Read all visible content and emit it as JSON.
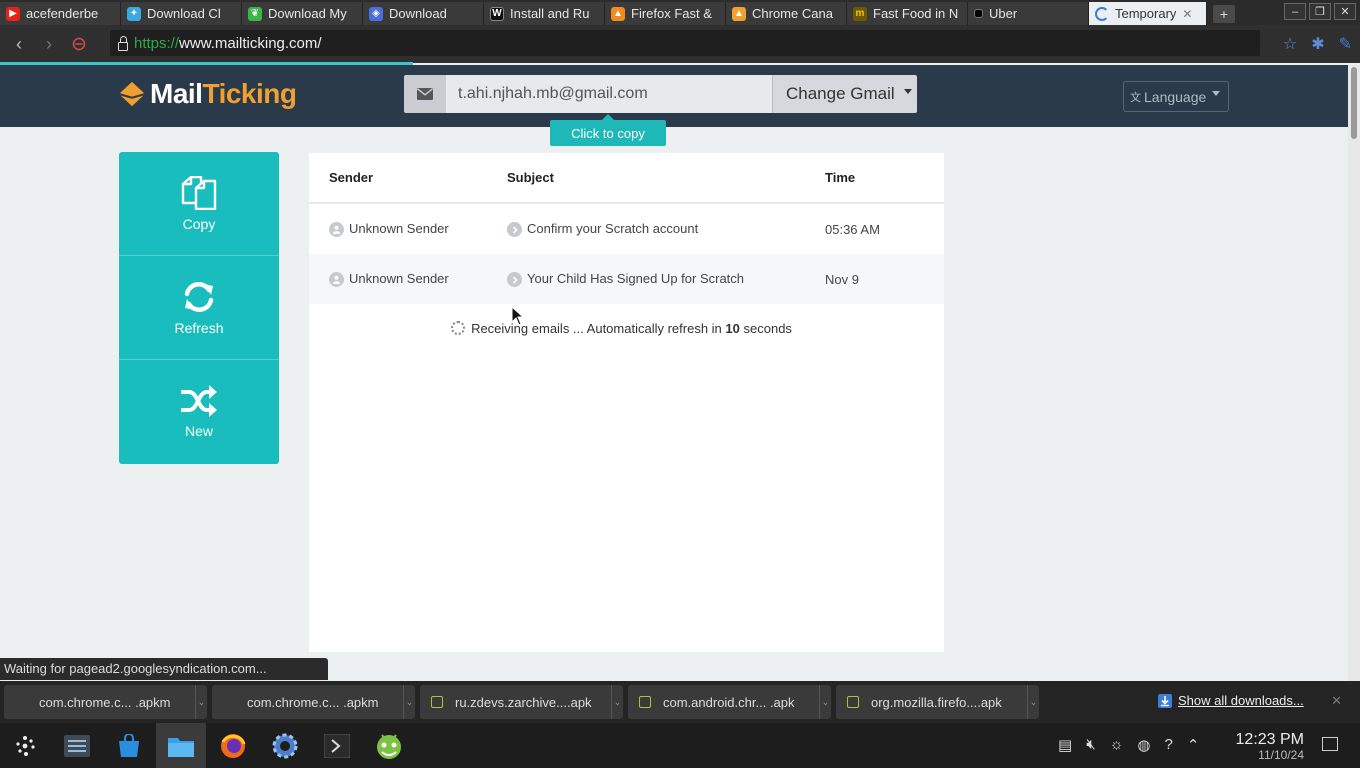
{
  "browser": {
    "tabs": [
      {
        "title": "acefenderbe",
        "icon": "youtube-icon",
        "color": "#e62117"
      },
      {
        "title": "Download Cl",
        "icon": "bird-icon",
        "color": "#3ba8e0"
      },
      {
        "title": "Download My",
        "icon": "leaf-icon",
        "color": "#3bb54a"
      },
      {
        "title": "Download",
        "icon": "gamepad-icon",
        "color": "#4a6ee0"
      },
      {
        "title": "Install and Ru",
        "icon": "wikipedia-icon",
        "color": "#111111"
      },
      {
        "title": "Firefox Fast &",
        "icon": "firefox-icon",
        "color": "#f08c1e"
      },
      {
        "title": "Chrome Cana",
        "icon": "canary-icon",
        "color": "#f0a030"
      },
      {
        "title": "Fast Food in N",
        "icon": "mcdonalds-icon",
        "color": "#f4c400"
      },
      {
        "title": "Uber",
        "icon": "uber-icon",
        "color": "#000000"
      },
      {
        "title": "Temporary",
        "icon": "loading-icon",
        "color": "#3b7dd8",
        "active": true
      }
    ],
    "url_scheme": "https://",
    "url_rest": "www.mailticking.com/"
  },
  "site": {
    "logo_main": "Mail",
    "logo_accent": "Ticking",
    "email_value": "t.ahi.njhah.mb@gmail.com",
    "change_button": "Change Gmail",
    "tooltip": "Click to copy",
    "language_button": "Language",
    "accent_color": "#19bdbd"
  },
  "actions": [
    {
      "label": "Copy",
      "icon": "copy-icon"
    },
    {
      "label": "Refresh",
      "icon": "refresh-icon"
    },
    {
      "label": "New",
      "icon": "shuffle-icon"
    }
  ],
  "mail": {
    "headers": {
      "sender": "Sender",
      "subject": "Subject",
      "time": "Time"
    },
    "rows": [
      {
        "sender": "Unknown Sender",
        "subject": "Confirm your Scratch account",
        "time": "05:36 AM"
      },
      {
        "sender": "Unknown Sender",
        "subject": "Your Child Has Signed Up for Scratch",
        "time": "Nov 9"
      }
    ],
    "status_prefix": "Receiving emails ... Automatically refresh in",
    "status_seconds": "10",
    "status_suffix": "seconds"
  },
  "status_bar": "Waiting for pagead2.googlesyndication.com...",
  "downloads": {
    "items": [
      {
        "name": "com.chrome.c... .apkm",
        "icon": "file-icon"
      },
      {
        "name": "com.chrome.c... .apkm",
        "icon": "file-icon"
      },
      {
        "name": "ru.zdevs.zarchive....apk",
        "icon": "android-package-icon"
      },
      {
        "name": "com.android.chr... .apk",
        "icon": "android-package-icon"
      },
      {
        "name": "org.mozilla.firefo....apk",
        "icon": "android-package-icon"
      }
    ],
    "show_all": "Show all downloads..."
  },
  "taskbar": {
    "time": "12:23 PM",
    "date": "11/10/24"
  }
}
